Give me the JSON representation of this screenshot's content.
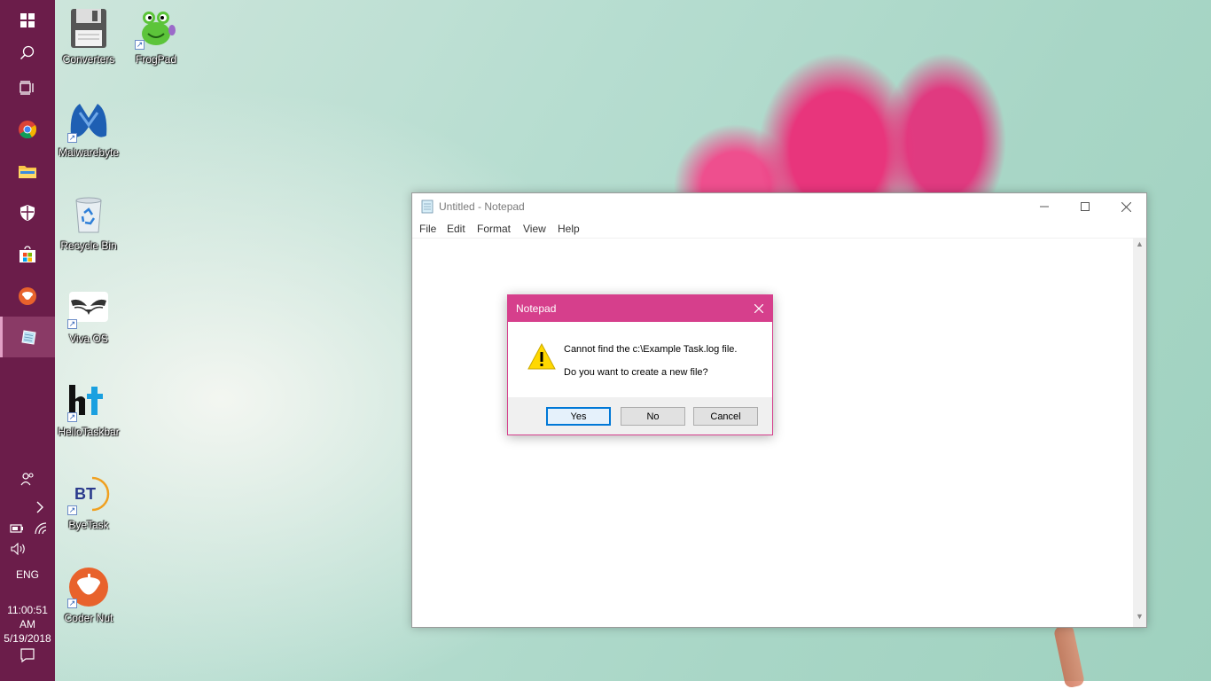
{
  "taskbar": {
    "items": [
      {
        "name": "start",
        "icon": "windows-logo-icon"
      },
      {
        "name": "search",
        "icon": "search-icon"
      },
      {
        "name": "task-view",
        "icon": "task-view-icon"
      },
      {
        "name": "chrome",
        "icon": "chrome-icon"
      },
      {
        "name": "file-explorer",
        "icon": "folder-icon"
      },
      {
        "name": "security",
        "icon": "shield-icon"
      },
      {
        "name": "store",
        "icon": "store-icon"
      },
      {
        "name": "coder-nut",
        "icon": "acorn-icon"
      },
      {
        "name": "notepad",
        "icon": "notepad-icon"
      }
    ],
    "language": "ENG",
    "time": "11:00:51 AM",
    "date": "5/19/2018"
  },
  "desktop": {
    "icons": [
      {
        "label": "Converters",
        "icon": "floppy-disk-icon"
      },
      {
        "label": "FrogPad",
        "icon": "frog-icon"
      },
      {
        "label": "Malwarebyte",
        "icon": "malwarebytes-icon"
      },
      {
        "label": "Recycle Bin",
        "icon": "recycle-bin-icon"
      },
      {
        "label": "Viva OS",
        "icon": "wings-icon"
      },
      {
        "label": "HelloTaskbar",
        "icon": "ht-logo-icon"
      },
      {
        "label": "ByeTask",
        "icon": "bt-logo-icon"
      },
      {
        "label": "Coder Nut",
        "icon": "acorn-icon"
      }
    ]
  },
  "notepad": {
    "title": "Untitled - Notepad",
    "menu": [
      "File",
      "Edit",
      "Format",
      "View",
      "Help"
    ]
  },
  "dialog": {
    "title": "Notepad",
    "message_line1": "Cannot find the c:\\Example Task.log file.",
    "message_line2": "Do you want to create a new file?",
    "buttons": {
      "yes": "Yes",
      "no": "No",
      "cancel": "Cancel"
    }
  },
  "colors": {
    "taskbar": "#6b1d4a",
    "dialog_accent": "#d63f8c",
    "default_button_border": "#0078d7"
  }
}
